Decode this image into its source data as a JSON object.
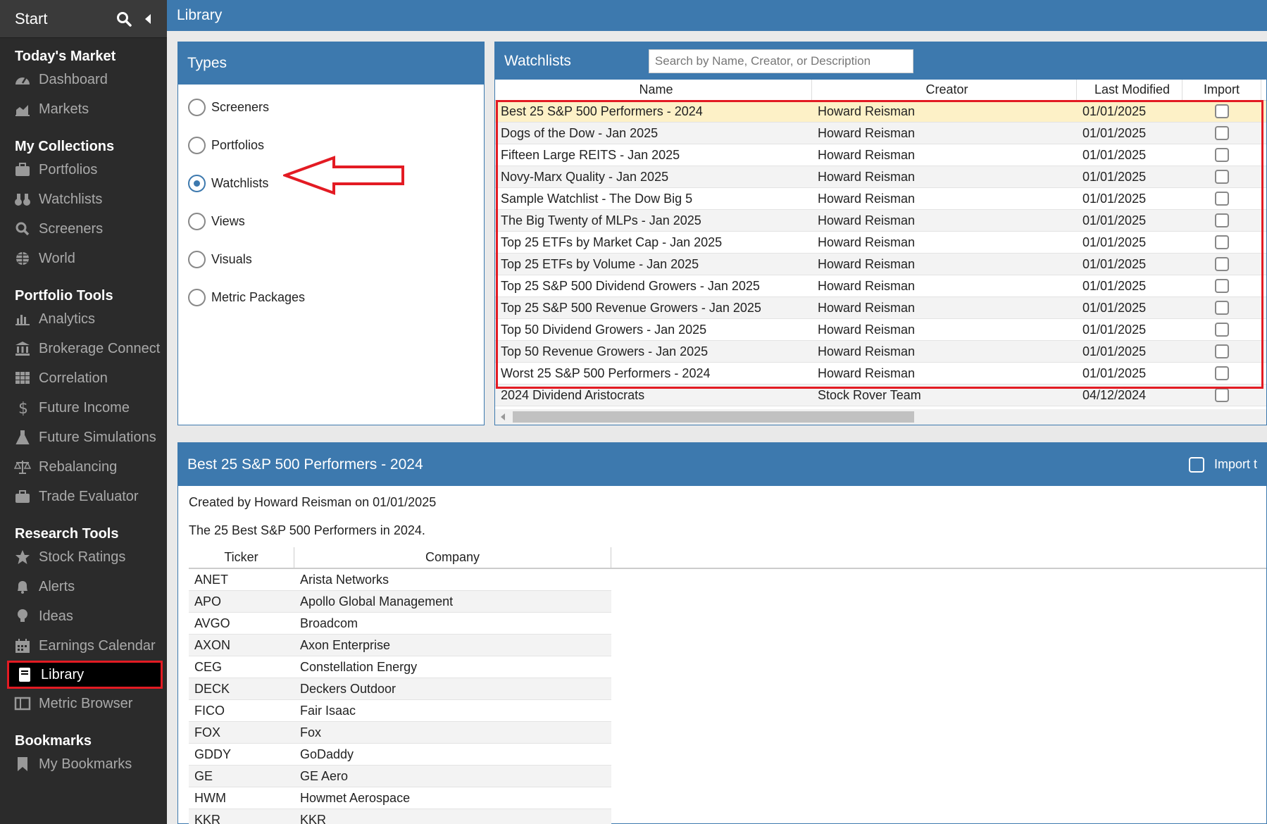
{
  "sidebar": {
    "start": "Start",
    "sections": [
      {
        "title": "Today's Market",
        "items": [
          {
            "label": "Dashboard",
            "icon": "dashboard-icon"
          },
          {
            "label": "Markets",
            "icon": "chart-area-icon"
          }
        ]
      },
      {
        "title": "My Collections",
        "items": [
          {
            "label": "Portfolios",
            "icon": "briefcase-icon"
          },
          {
            "label": "Watchlists",
            "icon": "binoculars-icon"
          },
          {
            "label": "Screeners",
            "icon": "search-icon"
          },
          {
            "label": "World",
            "icon": "globe-icon"
          }
        ]
      },
      {
        "title": "Portfolio Tools",
        "items": [
          {
            "label": "Analytics",
            "icon": "bar-chart-icon"
          },
          {
            "label": "Brokerage Connect",
            "icon": "bank-icon"
          },
          {
            "label": "Correlation",
            "icon": "grid-icon"
          },
          {
            "label": "Future Income",
            "icon": "dollar-icon"
          },
          {
            "label": "Future Simulations",
            "icon": "flask-icon"
          },
          {
            "label": "Rebalancing",
            "icon": "scale-icon"
          },
          {
            "label": "Trade Evaluator",
            "icon": "toolbox-icon"
          }
        ]
      },
      {
        "title": "Research Tools",
        "items": [
          {
            "label": "Stock Ratings",
            "icon": "star-icon"
          },
          {
            "label": "Alerts",
            "icon": "bell-icon"
          },
          {
            "label": "Ideas",
            "icon": "lightbulb-icon"
          },
          {
            "label": "Earnings Calendar",
            "icon": "calendar-icon"
          },
          {
            "label": "Library",
            "icon": "book-icon",
            "active": true
          },
          {
            "label": "Metric Browser",
            "icon": "columns-icon"
          }
        ]
      },
      {
        "title": "Bookmarks",
        "items": [
          {
            "label": "My Bookmarks",
            "icon": "bookmark-icon"
          }
        ]
      }
    ]
  },
  "topbar": {
    "title": "Library"
  },
  "types": {
    "title": "Types",
    "options": [
      "Screeners",
      "Portfolios",
      "Watchlists",
      "Views",
      "Visuals",
      "Metric Packages"
    ],
    "selected": "Watchlists"
  },
  "watchlists": {
    "title": "Watchlists",
    "search_placeholder": "Search by Name, Creator, or Description",
    "columns": {
      "name": "Name",
      "creator": "Creator",
      "modified": "Last Modified",
      "import": "Import"
    },
    "rows": [
      {
        "name": "Best 25 S&P 500 Performers - 2024",
        "creator": "Howard Reisman",
        "modified": "01/01/2025"
      },
      {
        "name": "Dogs of the Dow - Jan 2025",
        "creator": "Howard Reisman",
        "modified": "01/01/2025"
      },
      {
        "name": "Fifteen Large REITS - Jan 2025",
        "creator": "Howard Reisman",
        "modified": "01/01/2025"
      },
      {
        "name": "Novy-Marx Quality - Jan 2025",
        "creator": "Howard Reisman",
        "modified": "01/01/2025"
      },
      {
        "name": "Sample Watchlist - The Dow Big 5",
        "creator": "Howard Reisman",
        "modified": "01/01/2025"
      },
      {
        "name": "The Big Twenty of MLPs - Jan 2025",
        "creator": "Howard Reisman",
        "modified": "01/01/2025"
      },
      {
        "name": "Top 25 ETFs by Market Cap - Jan 2025",
        "creator": "Howard Reisman",
        "modified": "01/01/2025"
      },
      {
        "name": "Top 25 ETFs by Volume - Jan 2025",
        "creator": "Howard Reisman",
        "modified": "01/01/2025"
      },
      {
        "name": "Top 25 S&P 500 Dividend Growers - Jan 2025",
        "creator": "Howard Reisman",
        "modified": "01/01/2025"
      },
      {
        "name": "Top 25 S&P 500 Revenue Growers - Jan 2025",
        "creator": "Howard Reisman",
        "modified": "01/01/2025"
      },
      {
        "name": "Top 50 Dividend Growers - Jan 2025",
        "creator": "Howard Reisman",
        "modified": "01/01/2025"
      },
      {
        "name": "Top 50 Revenue Growers - Jan 2025",
        "creator": "Howard Reisman",
        "modified": "01/01/2025"
      },
      {
        "name": "Worst 25 S&P 500 Performers - 2024",
        "creator": "Howard Reisman",
        "modified": "01/01/2025"
      },
      {
        "name": "2024 Dividend Aristocrats",
        "creator": "Stock Rover Team",
        "modified": "04/12/2024"
      }
    ]
  },
  "detail": {
    "title": "Best 25 S&P 500 Performers - 2024",
    "import_label": "Import t",
    "created": "Created by Howard Reisman on 01/01/2025",
    "description": "The 25 Best S&P 500 Performers in 2024.",
    "columns": {
      "ticker": "Ticker",
      "company": "Company"
    },
    "rows": [
      {
        "ticker": "ANET",
        "company": "Arista Networks"
      },
      {
        "ticker": "APO",
        "company": "Apollo Global Management"
      },
      {
        "ticker": "AVGO",
        "company": "Broadcom"
      },
      {
        "ticker": "AXON",
        "company": "Axon Enterprise"
      },
      {
        "ticker": "CEG",
        "company": "Constellation Energy"
      },
      {
        "ticker": "DECK",
        "company": "Deckers Outdoor"
      },
      {
        "ticker": "FICO",
        "company": "Fair Isaac"
      },
      {
        "ticker": "FOX",
        "company": "Fox"
      },
      {
        "ticker": "GDDY",
        "company": "GoDaddy"
      },
      {
        "ticker": "GE",
        "company": "GE Aero"
      },
      {
        "ticker": "HWM",
        "company": "Howmet Aerospace"
      },
      {
        "ticker": "KKR",
        "company": "KKR"
      }
    ]
  },
  "colors": {
    "accent": "#3d79ae",
    "highlight": "#e31b23",
    "selected_row": "#fdf1c7"
  }
}
